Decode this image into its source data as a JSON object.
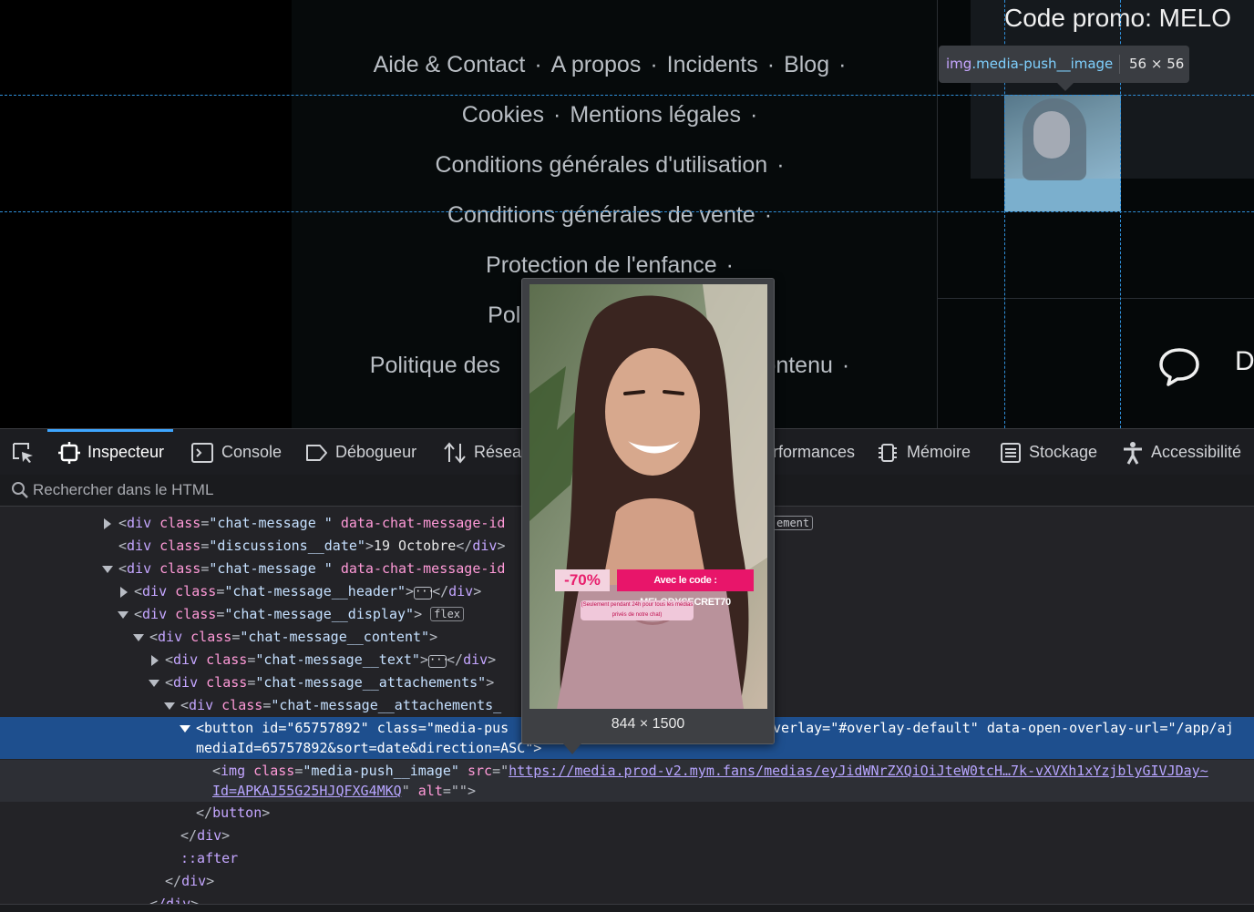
{
  "footer": {
    "rows": [
      [
        "Aide & Contact",
        "A propos",
        "Incidents",
        "Blog"
      ],
      [
        "Cookies",
        "Mentions légales"
      ],
      [
        "Conditions générales d'utilisation"
      ],
      [
        "Conditions générales de vente"
      ],
      [
        "Protection de l'enfance"
      ],
      [
        "Poli"
      ],
      [
        "Politique des",
        "contenu"
      ]
    ],
    "separator": "·"
  },
  "right_panel": {
    "promo_title": "Code promo: MELO",
    "chat_letter": "D"
  },
  "highlighter_tooltip": {
    "tag": "img",
    "class": ".media-push__image",
    "dims": "56 × 56"
  },
  "devtools": {
    "tabs": [
      {
        "label": "Inspecteur",
        "icon": "inspector-icon",
        "active": true
      },
      {
        "label": "Console",
        "icon": "console-icon"
      },
      {
        "label": "Débogueur",
        "icon": "debugger-icon"
      },
      {
        "label": "Réseau",
        "icon": "network-icon"
      },
      {
        "label": "Performances",
        "icon": "performance-icon"
      },
      {
        "label": "Mémoire",
        "icon": "memory-icon"
      },
      {
        "label": "Stockage",
        "icon": "storage-icon"
      },
      {
        "label": "Accessibilité",
        "icon": "accessibility-icon"
      }
    ],
    "tab_visible": {
      "reseau": "Résea",
      "performances": "rformances"
    },
    "search_placeholder": "Rechercher dans le HTML",
    "tree": {
      "l1_a": "div",
      "l1_b": "class",
      "l1_c": "\"chat-message \"",
      "l1_d": "data-chat-message-id",
      "l2_a": "div",
      "l2_b": "class",
      "l2_c": "\"discussions__date\"",
      "l2_text": "19 Octobre",
      "l3_a": "div",
      "l3_b": "class",
      "l3_c": "\"chat-message \"",
      "l3_d": "data-chat-message-id",
      "l4_c": "\"chat-message__header\"",
      "l5_c": "\"chat-message__display\"",
      "l5_badge": "flex",
      "l6_c": "\"chat-message__content\"",
      "l7_c": "\"chat-message__text\"",
      "l8_c": "\"chat-message__attachements\"",
      "l9_c": "\"chat-message__attachements_",
      "l10_a": "button",
      "l10_b": "id",
      "l10_c": "\"65757892\"",
      "l10_d": "class",
      "l10_e": "\"media-pus",
      "l10_right_a": "verlay=\"#overlay-default\"",
      "l10_right_b": "data-open-overlay-url",
      "l10_right_c": "\"/app/aj",
      "l10_cont": "mediaId=65757892&sort=date&direction=ASC\"",
      "l11_a": "img",
      "l11_b": "class",
      "l11_c": "\"media-push__image\"",
      "l11_d": "src",
      "l11_link": "https://media.prod-v2.mym.fans/medias/eyJidWNrZXQiOiJteW0tcH…7k-vXVXh1xYzjblyGIVJDay~",
      "l11_cont_link": "Id=APKAJ55G25HJQFXG4MKQ",
      "l11_alt": "alt",
      "l12": "button",
      "l13": "div",
      "l14": "::after",
      "l15": "div",
      "l16": "/div",
      "event_badge_visible": "ement"
    }
  },
  "image_preview": {
    "dims": "844 × 1500",
    "promo_discount": "-70%",
    "promo_code": "Avec le code : MELODYSECRET70",
    "promo_note": "(Seulement pendant 24h pour tous les médias privés de notre chat)"
  },
  "colors": {
    "guide": "#2f8ed8",
    "selection": "#1e4f8e",
    "tag": "#c4a6ff",
    "attr": "#ff9ad8",
    "value": "#c5e0ff",
    "promo_pink": "#e8156a"
  }
}
